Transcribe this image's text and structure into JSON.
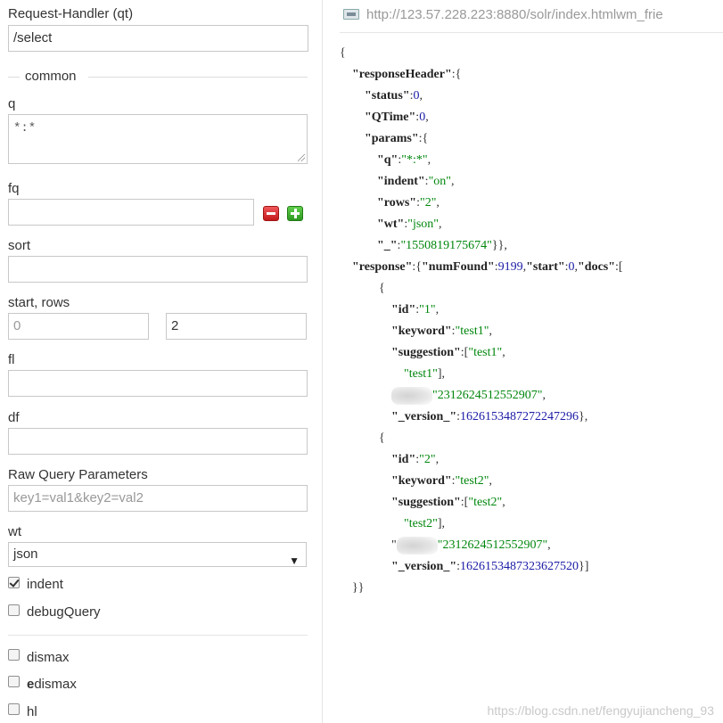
{
  "form": {
    "request_handler": {
      "label": "Request-Handler (qt)",
      "value": "/select"
    },
    "common_legend": "common",
    "q": {
      "label": "q",
      "value": "*:*"
    },
    "fq": {
      "label": "fq",
      "value": ""
    },
    "sort": {
      "label": "sort",
      "value": ""
    },
    "start_rows": {
      "label": "start, rows",
      "start_placeholder": "0",
      "rows_value": "2"
    },
    "fl": {
      "label": "fl",
      "value": ""
    },
    "df": {
      "label": "df",
      "value": ""
    },
    "raw_params": {
      "label": "Raw Query Parameters",
      "placeholder": "key1=val1&key2=val2"
    },
    "wt": {
      "label": "wt",
      "selected": "json"
    },
    "indent": {
      "label": "indent",
      "checked": true
    },
    "debug_query": {
      "label": "debugQuery",
      "checked": false
    },
    "dismax": {
      "label": "dismax",
      "checked": false
    },
    "edismax": {
      "label_bold": "e",
      "label_rest": "dismax",
      "checked": false
    },
    "hl": {
      "label": "hl",
      "checked": false
    }
  },
  "response": {
    "url": "http://123.57.228.223:8880/solr/index.htmlwm_frie",
    "status": "0",
    "qtime": "0",
    "params": {
      "q": "*:*",
      "indent": "on",
      "rows": "2",
      "wt": "json",
      "_": "1550819175674"
    },
    "num_found": "9199",
    "start": "0",
    "docs": [
      {
        "id": "1",
        "keyword": "test1",
        "suggestion_1": "test1",
        "suggestion_2": "test1",
        "blurred_value": "2312624512552907",
        "version": "1626153487272247296"
      },
      {
        "id": "2",
        "keyword": "test2",
        "suggestion_1": "test2",
        "suggestion_2": "test2",
        "blurred_value": "2312624512552907",
        "version": "1626153487323627520"
      }
    ]
  },
  "watermark": "https://blog.csdn.net/fengyujiancheng_93",
  "colors": {
    "json_string": "#00860c",
    "json_number": "#1a1aa6",
    "fq_remove": "#d9272a",
    "fq_add": "#3cae2c"
  }
}
